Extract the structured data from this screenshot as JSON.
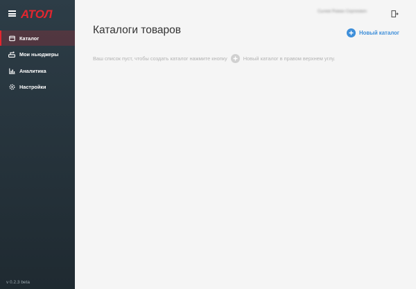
{
  "sidebar": {
    "logo_text": "АТОЛ",
    "items": [
      {
        "label": "Каталог",
        "icon": "catalog-icon",
        "active": true
      },
      {
        "label": "Мои ньюджеры",
        "icon": "scales-icon",
        "active": false
      },
      {
        "label": "Аналитика",
        "icon": "chart-icon",
        "active": false
      },
      {
        "label": "Настройки",
        "icon": "gear-icon",
        "active": false
      }
    ],
    "version": "v 0.2.3 beta"
  },
  "header": {
    "user_name": "Сычев Роман Сергеевич"
  },
  "main": {
    "title": "Каталоги товаров",
    "new_button_label": "Новый каталог",
    "empty_before": "Ваш список пуст, чтобы создать каталог нажмите кнопку",
    "empty_after": "Новый каталог в правом верхнем углу."
  },
  "colors": {
    "accent": "#3d8ed9",
    "brand": "#e3262f",
    "sidebar": "#2d3d47"
  }
}
